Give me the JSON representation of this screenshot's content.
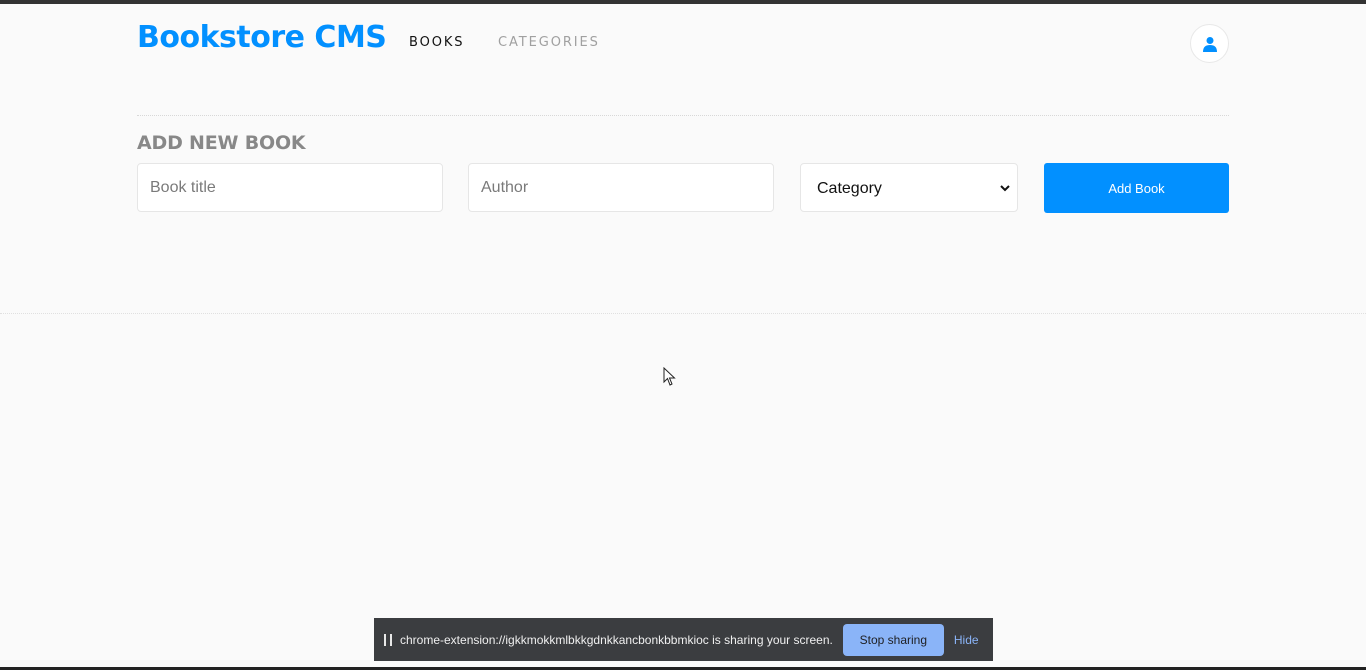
{
  "header": {
    "brand": "Bookstore CMS",
    "nav": {
      "books": "BOOKS",
      "categories": "CATEGORIES"
    },
    "user_icon": "user-icon"
  },
  "form": {
    "title": "ADD NEW BOOK",
    "book_title_placeholder": "Book title",
    "author_placeholder": "Author",
    "category_selected": "Category",
    "submit_label": "Add Book"
  },
  "share_bar": {
    "message": "chrome-extension://igkkmokkmlbkkgdnkkancbonkbbmkioc is sharing your screen.",
    "stop_label": "Stop sharing",
    "hide_label": "Hide"
  },
  "colors": {
    "accent": "#0290ff",
    "nav_active": "#121212",
    "nav_inactive": "#a0a0a0",
    "form_title": "#888888",
    "share_bar_bg": "#3b3d40",
    "stop_button": "#8ab4f8"
  }
}
